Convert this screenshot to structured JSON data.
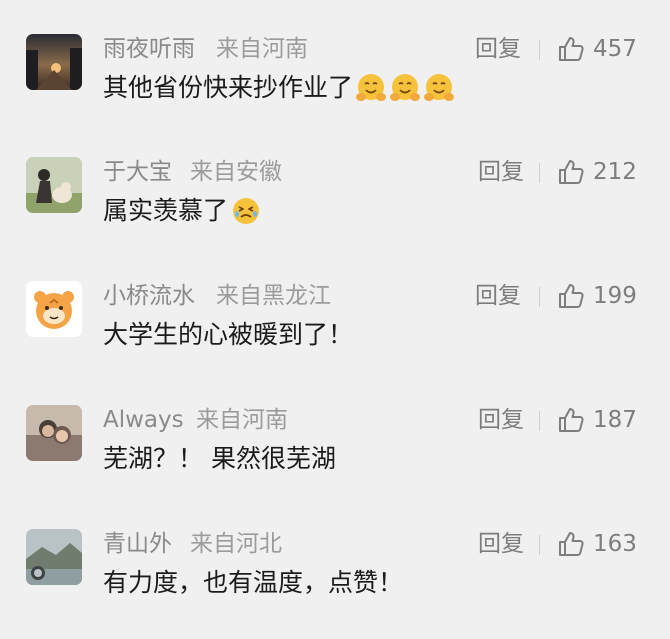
{
  "comments": [
    {
      "username": "雨夜听雨",
      "location": "来自河南",
      "text": "其他省份快来抄作业了",
      "emojis": [
        "hugging-face-icon",
        "hugging-face-icon",
        "hugging-face-icon"
      ],
      "reply_label": "回复",
      "likes": "457"
    },
    {
      "username": "于大宝",
      "location": "来自安徽",
      "text": "属实羡慕了",
      "emojis": [
        "crying-face-icon"
      ],
      "reply_label": "回复",
      "likes": "212"
    },
    {
      "username": "小桥流水",
      "location": "来自黑龙江",
      "text": "大学生的心被暖到了！",
      "emojis": [],
      "reply_label": "回复",
      "likes": "199"
    },
    {
      "username": "Always",
      "location": "来自河南",
      "text": "芜湖？！ 果然很芜湖",
      "emojis": [],
      "reply_label": "回复",
      "likes": "187"
    },
    {
      "username": "青山外",
      "location": "来自河北",
      "text": "有力度，也有温度，点赞！",
      "emojis": [],
      "reply_label": "回复",
      "likes": "163"
    }
  ],
  "colors": {
    "background": "#f0f0f0",
    "username": "#8a8a8a",
    "text": "#1b1b1b",
    "meta": "#7d7d7d"
  }
}
